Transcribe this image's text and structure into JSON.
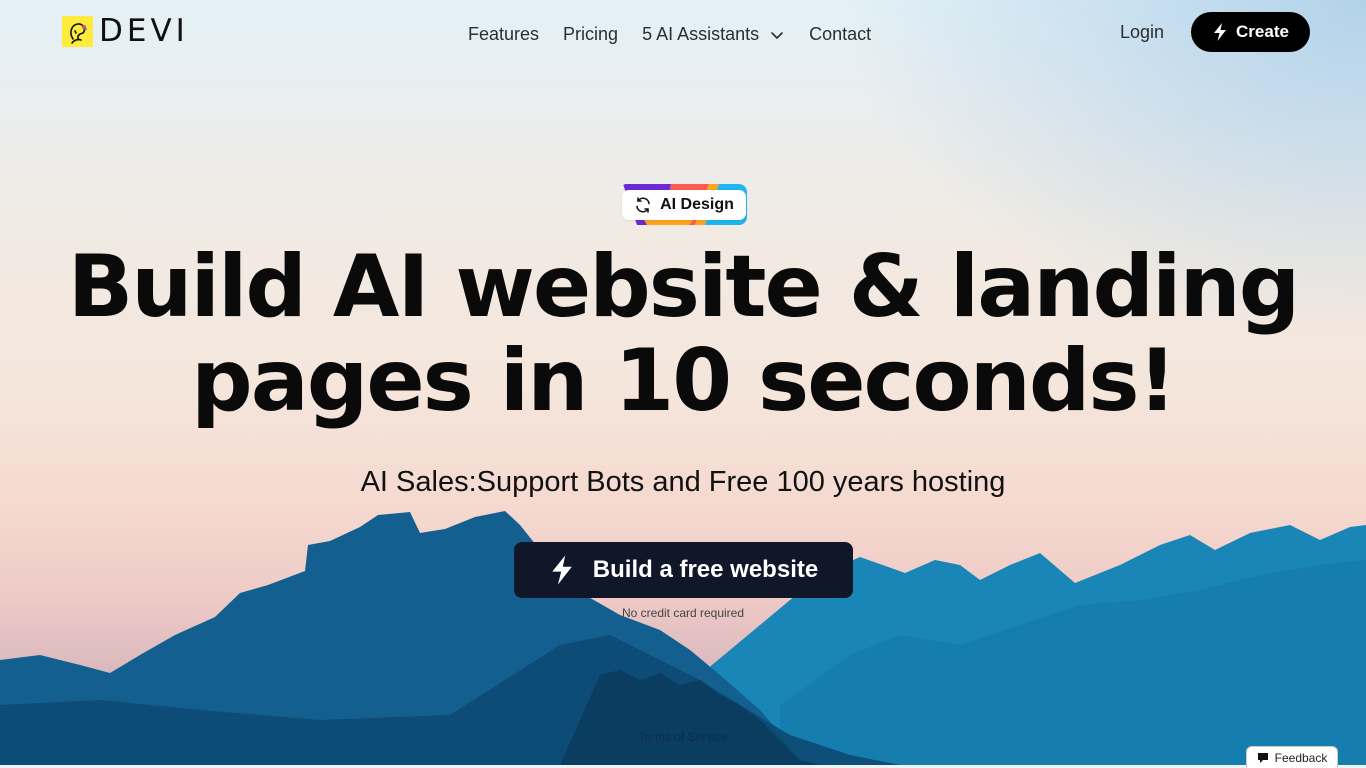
{
  "brand": {
    "name": "DEVI",
    "logo_color": "#ffeb3b"
  },
  "nav": {
    "links": [
      {
        "label": "Features"
      },
      {
        "label": "Pricing"
      },
      {
        "label": "5 AI Assistants",
        "has_dropdown": true
      },
      {
        "label": "Contact"
      }
    ],
    "login_label": "Login",
    "create_label": "Create"
  },
  "badge": {
    "label": "AI Design",
    "icon": "refresh-icon",
    "stripe_colors": [
      "#6a2bd6",
      "#ff5a4f",
      "#ffa51f",
      "#1eb7f0"
    ]
  },
  "hero": {
    "headline_line1": "Build AI website & landing",
    "headline_line2": "pages in 10 seconds!",
    "subheadline": "AI Sales:Support Bots and Free 100 years hosting",
    "cta_label": "Build a free website",
    "cta_icon": "lightning-icon",
    "cta_note": "No credit card required"
  },
  "footer": {
    "terms_label": "Terms of Service",
    "feedback_label": "Feedback"
  },
  "colors": {
    "cta_bg": "#0f1728",
    "create_bg": "#000000",
    "mountain_dark": "#0f5a8a",
    "mountain_light": "#1a86b8"
  }
}
